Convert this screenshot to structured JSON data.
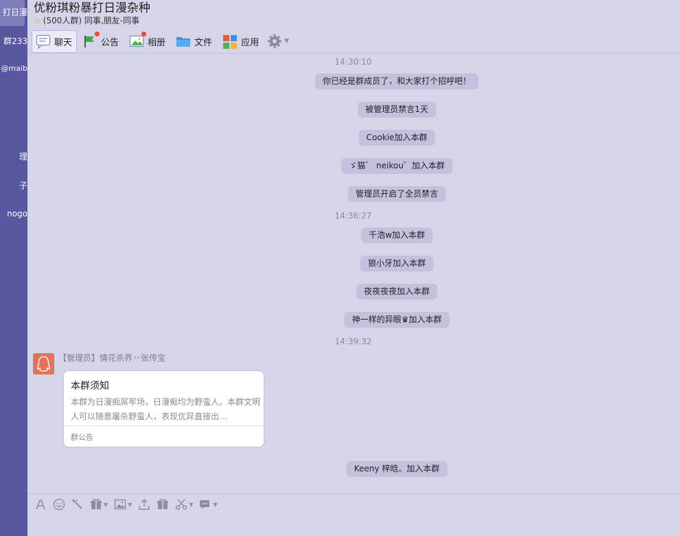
{
  "sidebar": {
    "items": [
      {
        "label": "打日漫"
      },
      {
        "label": "群233"
      },
      {
        "label": "@maib"
      },
      {
        "label": "理"
      },
      {
        "label": "子"
      },
      {
        "label": "nogo"
      }
    ]
  },
  "header": {
    "title": "优粉琪粉暴打日漫杂种",
    "star": "☆",
    "subtitle": "(500人群) 同事,朋友-同事"
  },
  "tabs": [
    {
      "label": "聊天",
      "icon": "chat-bubble-icon",
      "active": true
    },
    {
      "label": "公告",
      "icon": "announcement-flag-icon",
      "badge": true
    },
    {
      "label": "相册",
      "icon": "photo-album-icon",
      "badge": true
    },
    {
      "label": "文件",
      "icon": "folder-icon"
    },
    {
      "label": "应用",
      "icon": "apps-grid-icon"
    },
    {
      "label": "",
      "icon": "gear-icon"
    }
  ],
  "messages": {
    "time1": "14:30:10",
    "sys1": "你已经是群成员了，和大家打个招呼吧！",
    "sys2": "被管理员禁言1天",
    "sys3": "Cookie加入本群",
    "sys4": "ゞ猫゛ neikou゛加入本群",
    "sys5": "管理员开启了全员禁言",
    "time2": "14:36:27",
    "sys6": "千浩w加入本群",
    "sys7": "狼小牙加入本群",
    "sys8": "夜夜夜夜加入本群",
    "sys9": "神一样的异眼♛加入本群",
    "time3": "14:39:32",
    "sender": "【管理员】情花杀界丷张传宝",
    "card": {
      "title": "本群须知",
      "body": "本群为日漫痴屌牢场，日漫痴均为野蛮人。本群文明人可以随意屠杀野蛮人，表现优异直接出…",
      "footer": "群公告"
    },
    "sys10": "Keeny  梓晗。加入本群"
  },
  "toolbar": {
    "icons": [
      "font-icon",
      "emoji-icon",
      "magic-wand-icon",
      "gift-box-icon",
      "image-icon",
      "upload-icon",
      "gift-icon",
      "scissors-icon",
      "chat-record-icon"
    ]
  },
  "colors": {
    "background": "#d5d4e9",
    "sidebar": "#56579e",
    "system_pill": "#c3c1dd",
    "badge": "#e9453c"
  }
}
